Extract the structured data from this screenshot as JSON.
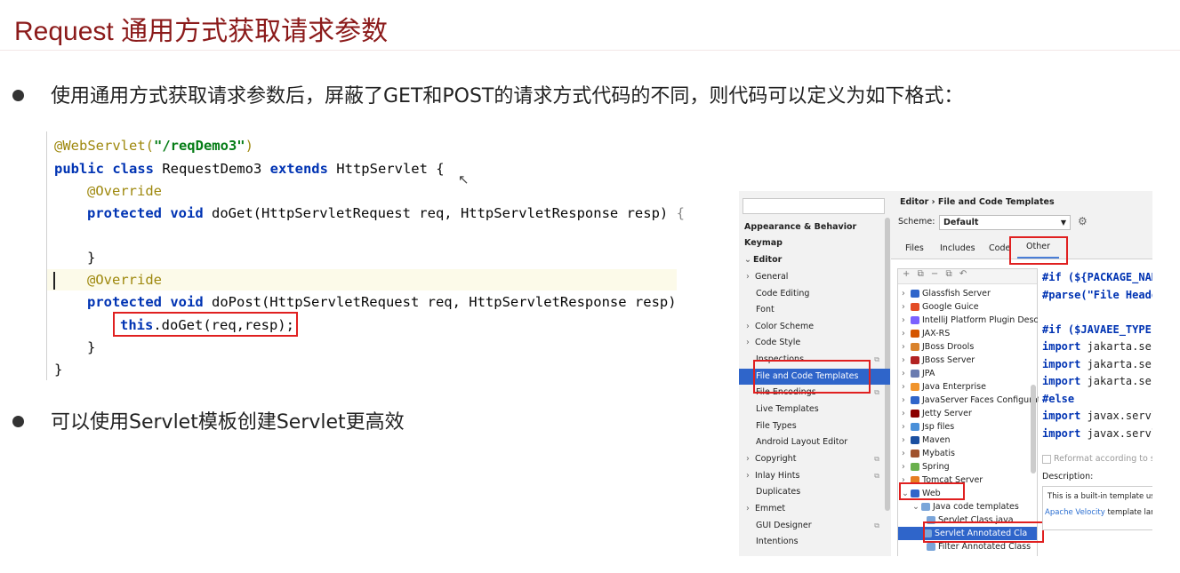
{
  "slide": {
    "title": "Request 通用方式获取请求参数",
    "bullet1": "使用通用方式获取请求参数后，屏蔽了GET和POST的请求方式代码的不同，则代码可以定义为如下格式：",
    "bullet2": "可以使用Servlet模板创建Servlet更高效"
  },
  "code": {
    "l1_annotation": "@WebServlet(",
    "l1_string": "\"/reqDemo3\"",
    "l1_end": ")",
    "l2_kw1": "public class",
    "l2_name": " RequestDemo3 ",
    "l2_kw2": "extends",
    "l2_rest": " HttpServlet {",
    "l3": "@Override",
    "l4_kw": "protected void",
    "l4_rest": " doGet(HttpServletRequest req, HttpServletResponse resp) ",
    "l4_fold": "{",
    "l6": "}",
    "l7": "@Override",
    "l8_kw": "protected void",
    "l8_rest": " doPost(HttpServletRequest req, HttpServletResponse resp)",
    "l9_kw": "this",
    "l9_rest": ".doGet(req,resp);",
    "l10": "}",
    "l11": "}"
  },
  "ide": {
    "nav": [
      {
        "label": "Appearance & Behavior",
        "bold": true
      },
      {
        "label": "Keymap",
        "bold": true
      },
      {
        "label": "Editor",
        "bold": true
      },
      {
        "label": "General"
      },
      {
        "label": "Code Editing"
      },
      {
        "label": "Font"
      },
      {
        "label": "Color Scheme"
      },
      {
        "label": "Code Style"
      },
      {
        "label": "Inspections"
      },
      {
        "label": "File and Code Templates",
        "selected": true
      },
      {
        "label": "File Encodings"
      },
      {
        "label": "Live Templates"
      },
      {
        "label": "File Types"
      },
      {
        "label": "Android Layout Editor"
      },
      {
        "label": "Copyright"
      },
      {
        "label": "Inlay Hints"
      },
      {
        "label": "Duplicates"
      },
      {
        "label": "Emmet"
      },
      {
        "label": "GUI Designer"
      },
      {
        "label": "Intentions"
      }
    ],
    "breadcrumb_1": "Editor",
    "breadcrumb_sep": "›",
    "breadcrumb_2": "File and Code Templates",
    "scheme_label": "Scheme:",
    "scheme_value": "Default",
    "tabs": [
      "Files",
      "Includes",
      "Code",
      "Other"
    ],
    "active_tab": "Other",
    "toolbar_icons": [
      "+",
      "⧉",
      "−",
      "⧉",
      "↶"
    ],
    "tree": [
      "Glassfish Server",
      "Google Guice",
      "IntelliJ Platform Plugin Descr",
      "JAX-RS",
      "JBoss Drools",
      "JBoss Server",
      "JPA",
      "Java Enterprise",
      "JavaServer Faces Configurati",
      "Jetty Server",
      "Jsp files",
      "Maven",
      "Mybatis",
      "Spring",
      "Tomcat Server",
      "Web",
      "Java code templates",
      "Servlet Class.java",
      "Servlet Annotated Cla",
      "Filter Annotated Class"
    ],
    "editor_lines": [
      {
        "text": "#if (${PACKAGE_NAM",
        "kw": true
      },
      {
        "text": "#parse(\"File Heade",
        "kw": true
      },
      {
        "text": "",
        "kw": false
      },
      {
        "text": "#if ($JAVAEE_TYPE",
        "kw": true
      },
      {
        "text": "import jakarta.ser",
        "kw": false,
        "kwpart": "import"
      },
      {
        "text": "import jakarta.ser",
        "kw": false,
        "kwpart": "import"
      },
      {
        "text": "import jakarta.ser",
        "kw": false,
        "kwpart": "import"
      },
      {
        "text": "#else",
        "kw": true
      },
      {
        "text": "import javax.servl",
        "kw": false,
        "kwpart": "import"
      },
      {
        "text": "import javax.servl",
        "kw": false,
        "kwpart": "import"
      }
    ],
    "reformat": "Reformat according to st",
    "description_label": "Description:",
    "description_text": "This is a built-in template used",
    "velocity_link": "Apache Velocity",
    "velocity_rest": " template langua"
  }
}
